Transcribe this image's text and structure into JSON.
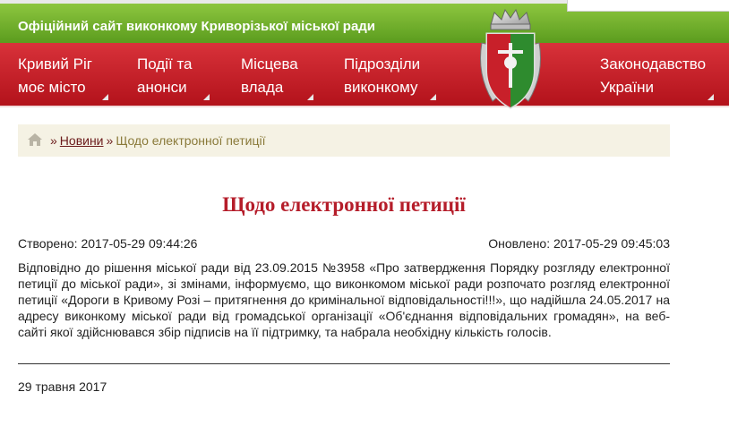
{
  "header": {
    "site_title": "Офіційний сайт виконкому Криворізької міської ради"
  },
  "nav": [
    {
      "line1": "Кривий Ріг",
      "line2": "моє місто"
    },
    {
      "line1": "Події та",
      "line2": "анонси"
    },
    {
      "line1": "Місцева",
      "line2": "влада"
    },
    {
      "line1": "Підрозділи",
      "line2": "виконкому"
    },
    {
      "line1": "Законодавство",
      "line2": "України"
    }
  ],
  "breadcrumb": {
    "sep": "»",
    "link": "Новини",
    "current": "Щодо електронної петиції"
  },
  "article": {
    "title": "Щодо електронної петиції",
    "created": "Створено: 2017-05-29 09:44:26",
    "updated": "Оновлено: 2017-05-29 09:45:03",
    "body": "Відповідно до рішення міської ради від 23.09.2015 №3958 «Про затвердження Порядку розгляду електронної петиції до міської ради», зі змінами, інформуємо, що виконкомом міської ради розпочато розгляд електронної петиції «Дороги в Кривому Розі – притягнення до кримінальної відповідальності!!!», що надійшла 24.05.2017 на адресу виконкому міської ради від громадської організації «Об'єднання відповідальних громадян», на веб-сайті якої здійснювався збір підписів на її підтримку, та набрала необхідну кількість голосів.",
    "date": "29 травня 2017"
  },
  "icons": {
    "home": "home-icon",
    "crest": "city-crest-icon"
  },
  "colors": {
    "green": "#6fb02e",
    "red": "#c8202a",
    "title_red": "#b51d2a",
    "breadcrumb_bg": "#f5f2e4"
  }
}
